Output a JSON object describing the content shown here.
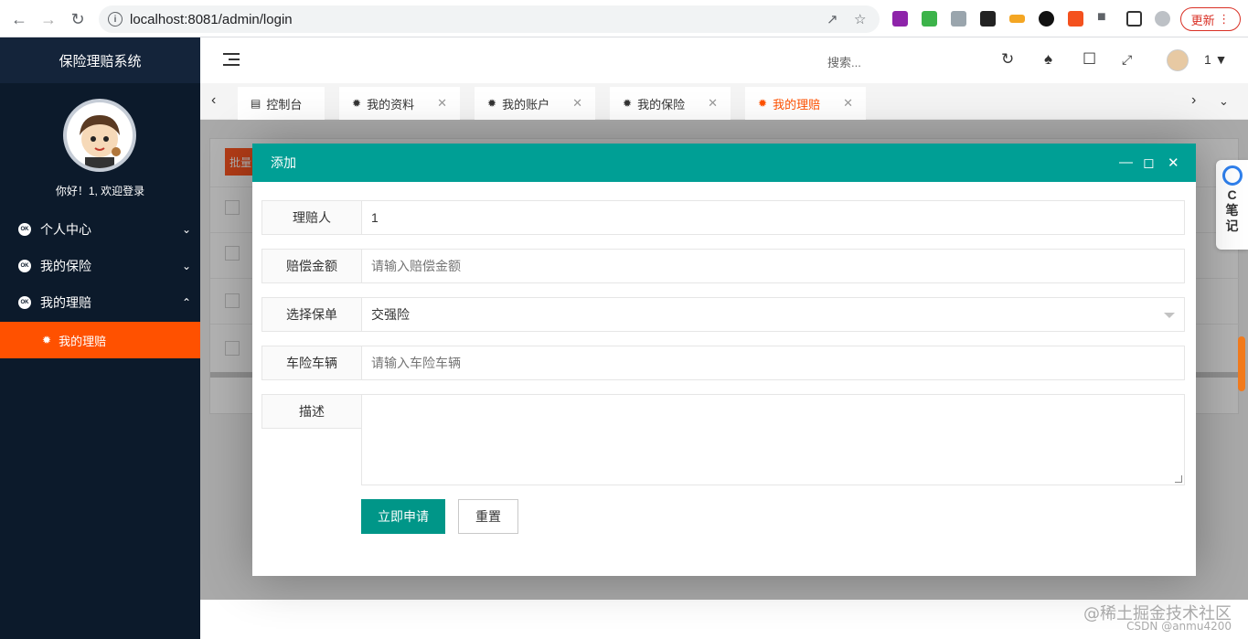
{
  "browser": {
    "url": "localhost:8081/admin/login",
    "update_label": "更新",
    "back_icon": "back-arrow-icon",
    "forward_icon": "forward-arrow-icon",
    "reload_icon": "reload-icon"
  },
  "sidebar": {
    "brand": "保险理赔系统",
    "welcome": "你好！1, 欢迎登录",
    "menu": [
      {
        "label": "个人中心",
        "expanded": false
      },
      {
        "label": "我的保险",
        "expanded": false
      },
      {
        "label": "我的理赔",
        "expanded": true
      }
    ],
    "active_sub": "我的理赔",
    "accent": "#ff5100",
    "bg": "#0c1a2b"
  },
  "header": {
    "search_placeholder": "搜索...",
    "user": "1"
  },
  "tabs": [
    {
      "label": "控制台",
      "closable": false,
      "active": false
    },
    {
      "label": "我的资料",
      "closable": true,
      "active": false
    },
    {
      "label": "我的账户",
      "closable": true,
      "active": false
    },
    {
      "label": "我的保险",
      "closable": true,
      "active": false
    },
    {
      "label": "我的理赔",
      "closable": true,
      "active": true
    }
  ],
  "background": {
    "batch_label": "批量"
  },
  "modal": {
    "title": "添加",
    "header_color": "#009f95",
    "fields": [
      {
        "label": "理赔人",
        "value": "1",
        "placeholder": ""
      },
      {
        "label": "赔偿金额",
        "value": "",
        "placeholder": "请输入赔偿金额"
      },
      {
        "label": "选择保单",
        "value": "交强险",
        "placeholder": ""
      },
      {
        "label": "车险车辆",
        "value": "",
        "placeholder": "请输入车险车辆"
      },
      {
        "label": "描述",
        "value": "",
        "placeholder": ""
      }
    ],
    "submit_label": "立即申请",
    "reset_label": "重置"
  },
  "note_widget": {
    "line1": "C",
    "line2": "笔",
    "line3": "记"
  },
  "watermark": {
    "line1": "@稀土掘金技术社区",
    "line2": "CSDN @anmu4200"
  }
}
